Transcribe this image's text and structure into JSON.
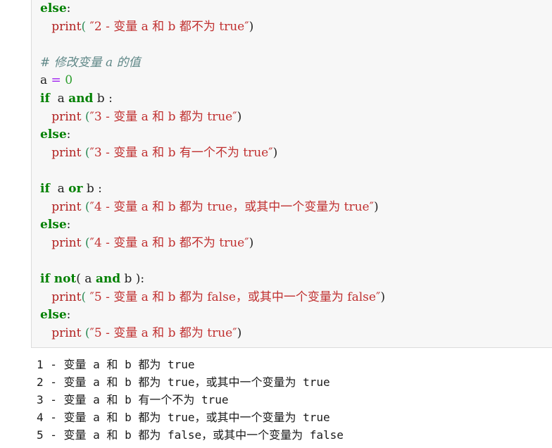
{
  "code_block": {
    "language": "python",
    "background": "#f7f7f7",
    "border_color": "#dcdcdc",
    "lines": [
      {
        "id": "line-else-2",
        "tokens": [
          {
            "t": "else",
            "c": "kw"
          },
          {
            "t": ":",
            "c": "pn"
          }
        ]
      },
      {
        "id": "line-print-2",
        "tokens": [
          {
            "t": "   ",
            "c": "pn"
          },
          {
            "t": "print",
            "c": "fn"
          },
          {
            "t": "(",
            "c": "gp"
          },
          {
            "t": " ″2 - 变量 a 和 b 都不为 true″",
            "c": "str"
          },
          {
            "t": ")",
            "c": "pn"
          }
        ]
      },
      {
        "id": "line-blank-1",
        "tokens": []
      },
      {
        "id": "line-comment",
        "tokens": [
          {
            "t": "# 修改变量 a 的值",
            "c": "cmt"
          }
        ]
      },
      {
        "id": "line-assign-a",
        "tokens": [
          {
            "t": "a ",
            "c": "id"
          },
          {
            "t": "=",
            "c": "op"
          },
          {
            "t": " ",
            "c": "pn"
          },
          {
            "t": "0",
            "c": "num"
          }
        ]
      },
      {
        "id": "line-if-and",
        "tokens": [
          {
            "t": "if",
            "c": "kw"
          },
          {
            "t": "  a ",
            "c": "id"
          },
          {
            "t": "and",
            "c": "kw"
          },
          {
            "t": " b :",
            "c": "id"
          }
        ]
      },
      {
        "id": "line-print-3-true",
        "tokens": [
          {
            "t": "   ",
            "c": "pn"
          },
          {
            "t": "print",
            "c": "fn"
          },
          {
            "t": " ",
            "c": "pn"
          },
          {
            "t": "(",
            "c": "gp"
          },
          {
            "t": "″3 - 变量 a 和 b 都为 true″",
            "c": "str"
          },
          {
            "t": ")",
            "c": "pn"
          }
        ]
      },
      {
        "id": "line-else-3",
        "tokens": [
          {
            "t": "else",
            "c": "kw"
          },
          {
            "t": ":",
            "c": "pn"
          }
        ]
      },
      {
        "id": "line-print-3-false",
        "tokens": [
          {
            "t": "   ",
            "c": "pn"
          },
          {
            "t": "print",
            "c": "fn"
          },
          {
            "t": " ",
            "c": "pn"
          },
          {
            "t": "(",
            "c": "gp"
          },
          {
            "t": "″3 - 变量 a 和 b 有一个不为 true″",
            "c": "str"
          },
          {
            "t": ")",
            "c": "pn"
          }
        ]
      },
      {
        "id": "line-blank-2",
        "tokens": []
      },
      {
        "id": "line-if-or",
        "tokens": [
          {
            "t": "if",
            "c": "kw"
          },
          {
            "t": "  a ",
            "c": "id"
          },
          {
            "t": "or",
            "c": "kw"
          },
          {
            "t": " b :",
            "c": "id"
          }
        ]
      },
      {
        "id": "line-print-4-true",
        "tokens": [
          {
            "t": "   ",
            "c": "pn"
          },
          {
            "t": "print",
            "c": "fn"
          },
          {
            "t": " ",
            "c": "pn"
          },
          {
            "t": "(",
            "c": "gp"
          },
          {
            "t": "″4 - 变量 a 和 b 都为 true，或其中一个变量为 true″",
            "c": "str"
          },
          {
            "t": ")",
            "c": "pn"
          }
        ]
      },
      {
        "id": "line-else-4",
        "tokens": [
          {
            "t": "else",
            "c": "kw"
          },
          {
            "t": ":",
            "c": "pn"
          }
        ]
      },
      {
        "id": "line-print-4-false",
        "tokens": [
          {
            "t": "   ",
            "c": "pn"
          },
          {
            "t": "print",
            "c": "fn"
          },
          {
            "t": " ",
            "c": "pn"
          },
          {
            "t": "(",
            "c": "gp"
          },
          {
            "t": "″4 - 变量 a 和 b 都不为 true″",
            "c": "str"
          },
          {
            "t": ")",
            "c": "pn"
          }
        ]
      },
      {
        "id": "line-blank-3",
        "tokens": []
      },
      {
        "id": "line-if-not",
        "tokens": [
          {
            "t": "if ",
            "c": "kw"
          },
          {
            "t": "not",
            "c": "kw"
          },
          {
            "t": "( a ",
            "c": "id"
          },
          {
            "t": "and",
            "c": "kw"
          },
          {
            "t": " b ):",
            "c": "id"
          }
        ]
      },
      {
        "id": "line-print-5-false",
        "tokens": [
          {
            "t": "   ",
            "c": "pn"
          },
          {
            "t": "print",
            "c": "fn"
          },
          {
            "t": "(",
            "c": "gp"
          },
          {
            "t": " ″5 - 变量 a 和 b 都为 false，或其中一个变量为 false″",
            "c": "str"
          },
          {
            "t": ")",
            "c": "pn"
          }
        ]
      },
      {
        "id": "line-else-5",
        "tokens": [
          {
            "t": "else",
            "c": "kw"
          },
          {
            "t": ":",
            "c": "pn"
          }
        ]
      },
      {
        "id": "line-print-5-true",
        "tokens": [
          {
            "t": "   ",
            "c": "pn"
          },
          {
            "t": "print",
            "c": "fn"
          },
          {
            "t": " ",
            "c": "pn"
          },
          {
            "t": "(",
            "c": "gp"
          },
          {
            "t": "″5 - 变量 a 和 b 都为 true″",
            "c": "str"
          },
          {
            "t": ")",
            "c": "pn"
          }
        ]
      }
    ]
  },
  "output": {
    "lines": [
      "1 - 变量 a 和 b 都为 true",
      "2 - 变量 a 和 b 都为 true，或其中一个变量为 true",
      "3 - 变量 a 和 b 有一个不为 true",
      "4 - 变量 a 和 b 都为 true，或其中一个变量为 true",
      "5 - 变量 a 和 b 都为 false，或其中一个变量为 false"
    ]
  },
  "colors": {
    "keyword": "#008000",
    "function": "#b22222",
    "string": "#c03030",
    "comment": "#5f8787",
    "operator": "#a020f0",
    "number": "#2f9f2f",
    "punctuation": "#222222",
    "code_background": "#f7f7f7",
    "page_background": "#ffffff"
  }
}
